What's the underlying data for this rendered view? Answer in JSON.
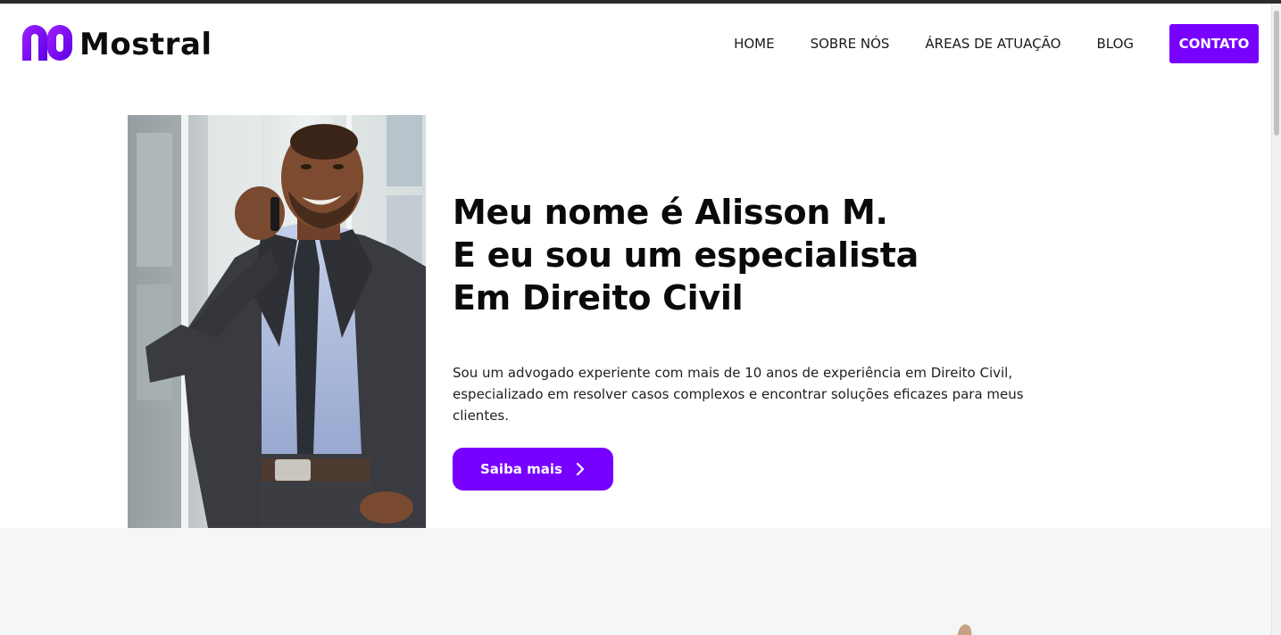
{
  "brand": {
    "name": "Mostral",
    "accent": "#7700ff",
    "logo_icon": "mostral-m-icon"
  },
  "nav": {
    "items": [
      "HOME",
      "SOBRE NÓS",
      "ÁREAS DE ATUAÇÃO",
      "BLOG"
    ],
    "cta": "CONTATO"
  },
  "hero": {
    "photo": "smiling-lawyer-on-phone-photo",
    "headline_lines": [
      "Meu nome é Alisson M.",
      "E eu sou um especialista",
      "Em Direito Civil"
    ],
    "description": "Sou um advogado experiente com mais de 10 anos de experiência em Direito Civil, especializado em resolver casos complexos e encontrar soluções eficazes para meus clientes.",
    "button_label": "Saiba mais",
    "button_icon": "chevron-right-icon"
  },
  "colors": {
    "lower_section_bg": "#f5f6f6",
    "text": "#0a0a0a"
  }
}
